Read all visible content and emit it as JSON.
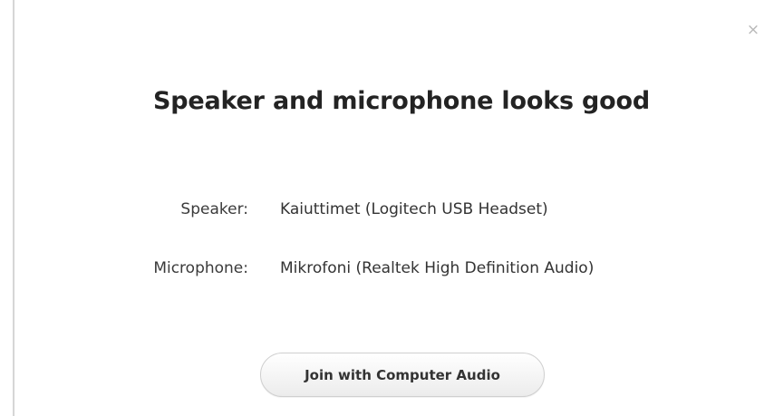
{
  "dialog": {
    "close_icon": "close-icon",
    "title": "Speaker and microphone looks good",
    "speaker": {
      "label": "Speaker:",
      "value": "Kaiuttimet (Logitech USB Headset)"
    },
    "microphone": {
      "label": "Microphone:",
      "value": "Mikrofoni (Realtek High Definition Audio)"
    },
    "join_button_label": "Join with Computer Audio"
  },
  "colors": {
    "background": "#ffffff",
    "title_text": "#232323",
    "body_text": "#333333",
    "button_border": "#cfcfcf",
    "close_icon": "#b8b8b8"
  }
}
